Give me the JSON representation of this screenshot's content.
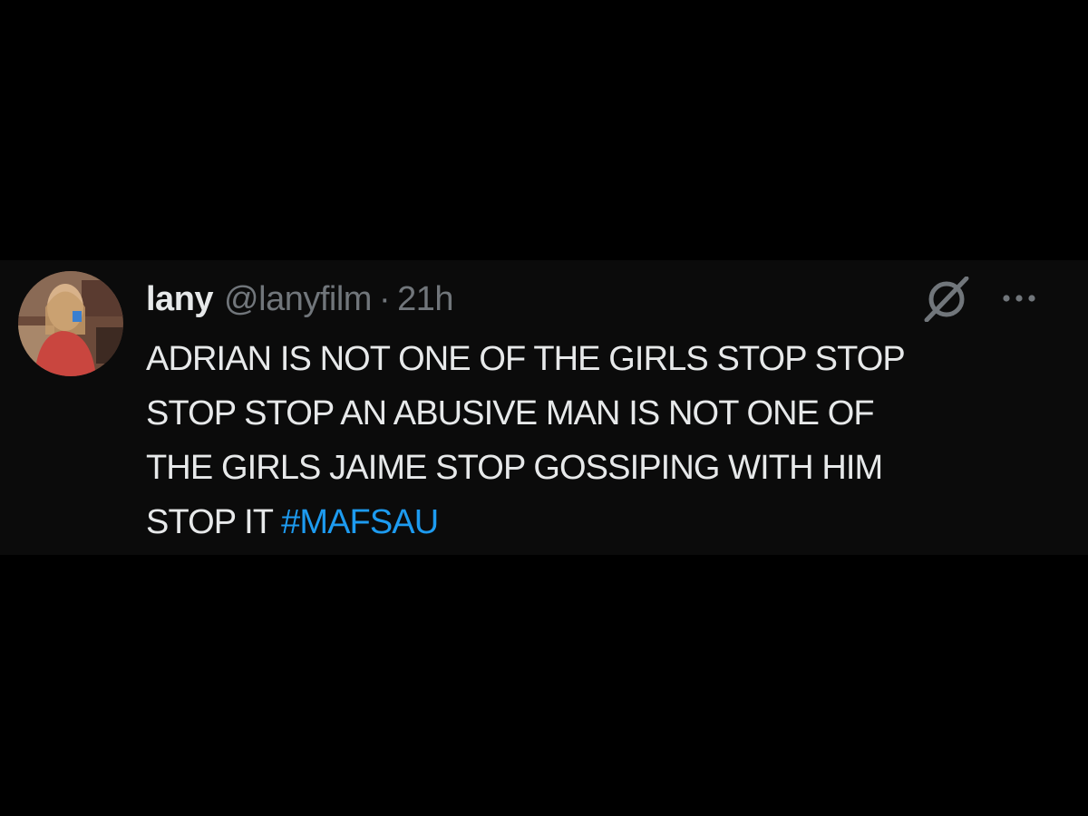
{
  "tweet": {
    "author": {
      "display_name": "lany",
      "handle": "@lanyfilm"
    },
    "separator": "·",
    "timestamp": "21h",
    "text_lines": [
      "ADRIAN IS NOT ONE OF THE GIRLS STOP STOP",
      "STOP STOP AN ABUSIVE MAN IS NOT ONE OF",
      "THE GIRLS JAIME STOP GOSSIPING WITH HIM",
      "STOP IT "
    ],
    "hashtag": "#MAFSAU",
    "icons": {
      "grok": "grok-icon",
      "more": "more-options-icon",
      "avatar": "avatar-photo"
    },
    "colors": {
      "background": "#0b0b0b",
      "text": "#e7e9ea",
      "secondary_text": "#71767b",
      "link": "#1d9bf0"
    }
  }
}
